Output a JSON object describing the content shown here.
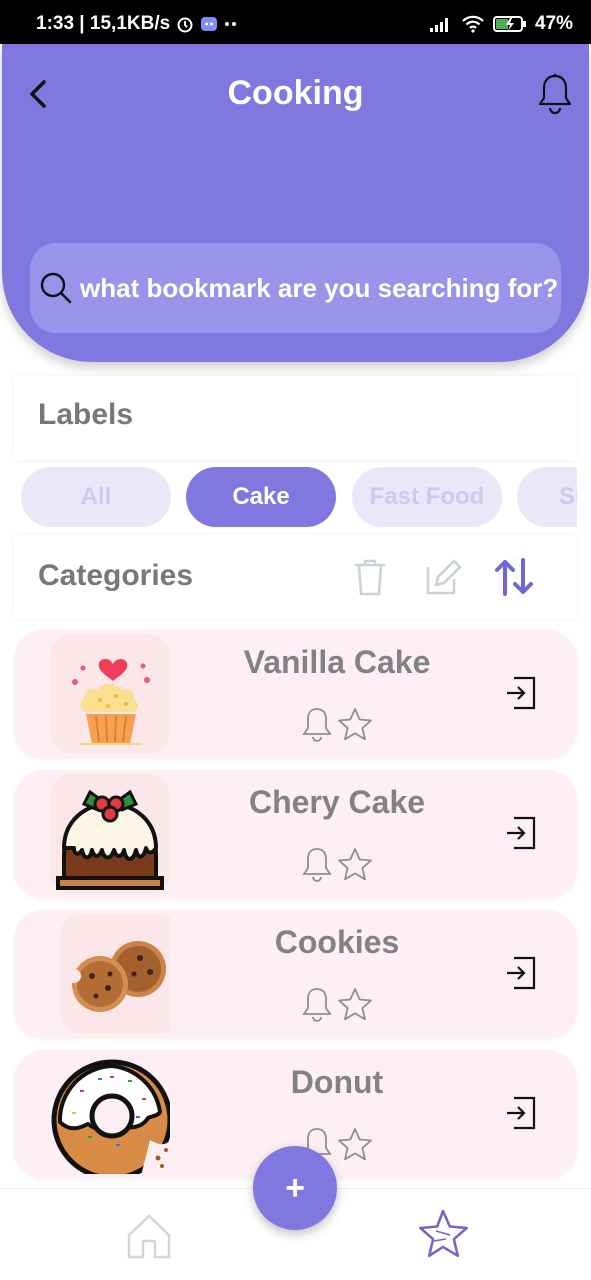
{
  "status_bar": {
    "time_speed": "1:33 | 15,1KB/s",
    "battery": "47%",
    "icons": [
      "alarm-icon",
      "discord-icon",
      "signal-icon",
      "wifi-icon",
      "battery-icon"
    ]
  },
  "header": {
    "title": "Cooking",
    "back_icon": "chevron-left-icon",
    "bell_icon": "bell-icon",
    "search_placeholder": "what bookmark are you searching for?"
  },
  "labels": {
    "title": "Labels",
    "chips": [
      {
        "label": "All",
        "active": false
      },
      {
        "label": "Cake",
        "active": true
      },
      {
        "label": "Fast Food",
        "active": false
      },
      {
        "label": "Su",
        "active": false
      }
    ]
  },
  "categories": {
    "title": "Categories",
    "tools": [
      "trash-icon",
      "edit-icon",
      "sort-icon"
    ],
    "items": [
      {
        "name": "Vanilla Cake",
        "image": "cupcake-icon"
      },
      {
        "name": "Chery Cake",
        "image": "pudding-cake-icon"
      },
      {
        "name": "Cookies",
        "image": "cookies-icon"
      },
      {
        "name": "Donut",
        "image": "donut-icon"
      }
    ]
  },
  "bottom_nav": {
    "home_icon": "home-icon",
    "add_label": "+",
    "favorites_icon": "star-icon"
  },
  "colors": {
    "accent": "#8078df",
    "item_bg": "#fdeff2",
    "chip_inactive": "#eae8f8",
    "text_gray": "#76787c"
  }
}
